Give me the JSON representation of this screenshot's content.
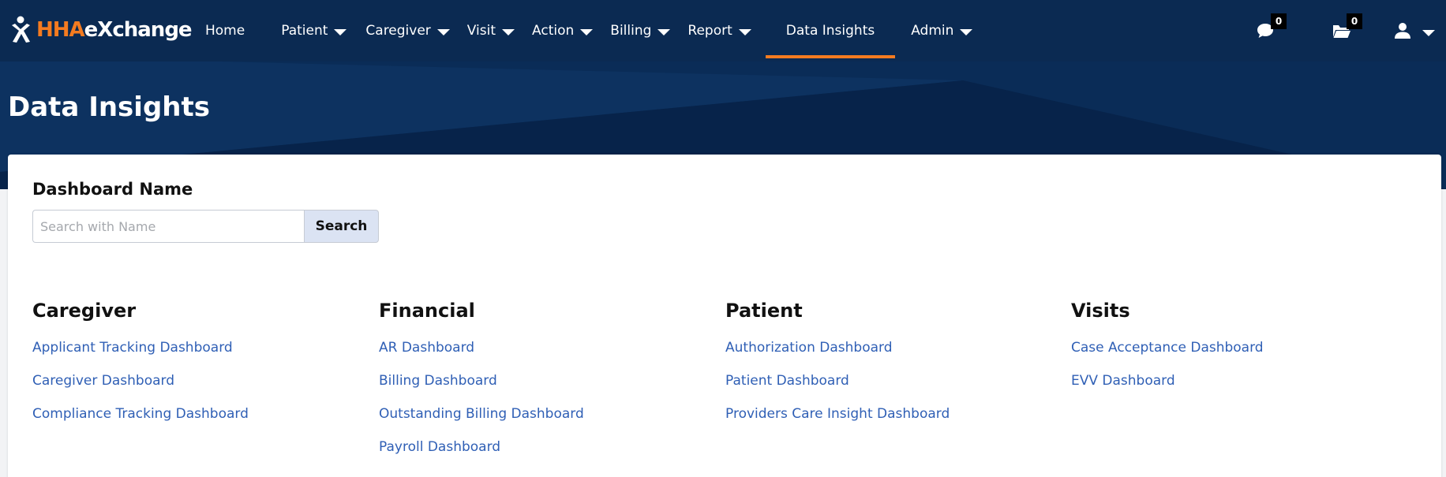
{
  "brand": {
    "logo_hha": "HHA",
    "logo_rest": "eXchange",
    "colors": {
      "navy": "#0b2a52",
      "accent": "#f47b20",
      "link": "#2f5fb5"
    }
  },
  "nav": {
    "items": [
      {
        "label": "Home",
        "dropdown": false
      },
      {
        "label": "Patient",
        "dropdown": true
      },
      {
        "label": "Caregiver",
        "dropdown": true
      },
      {
        "label": "Visit",
        "dropdown": true
      },
      {
        "label": "Action",
        "dropdown": true
      },
      {
        "label": "Billing",
        "dropdown": true
      },
      {
        "label": "Report",
        "dropdown": true
      },
      {
        "label": "Data Insights",
        "dropdown": false,
        "active": true
      },
      {
        "label": "Admin",
        "dropdown": true
      }
    ],
    "icons": {
      "chat": {
        "icon": "chat-bubble-icon",
        "count": "0"
      },
      "folder": {
        "icon": "folder-open-icon",
        "count": "0"
      },
      "user": {
        "icon": "user-icon"
      }
    }
  },
  "page": {
    "title": "Data Insights"
  },
  "search": {
    "label": "Dashboard Name",
    "placeholder": "Search with Name",
    "value": "",
    "button_label": "Search"
  },
  "categories": [
    {
      "title": "Caregiver",
      "links": [
        "Applicant Tracking Dashboard",
        "Caregiver Dashboard",
        "Compliance Tracking Dashboard"
      ]
    },
    {
      "title": "Financial",
      "links": [
        "AR Dashboard",
        "Billing Dashboard",
        "Outstanding Billing Dashboard",
        "Payroll Dashboard"
      ]
    },
    {
      "title": "Patient",
      "links": [
        "Authorization Dashboard",
        "Patient Dashboard",
        "Providers Care Insight Dashboard"
      ]
    },
    {
      "title": "Visits",
      "links": [
        "Case Acceptance Dashboard",
        "EVV Dashboard"
      ]
    }
  ]
}
